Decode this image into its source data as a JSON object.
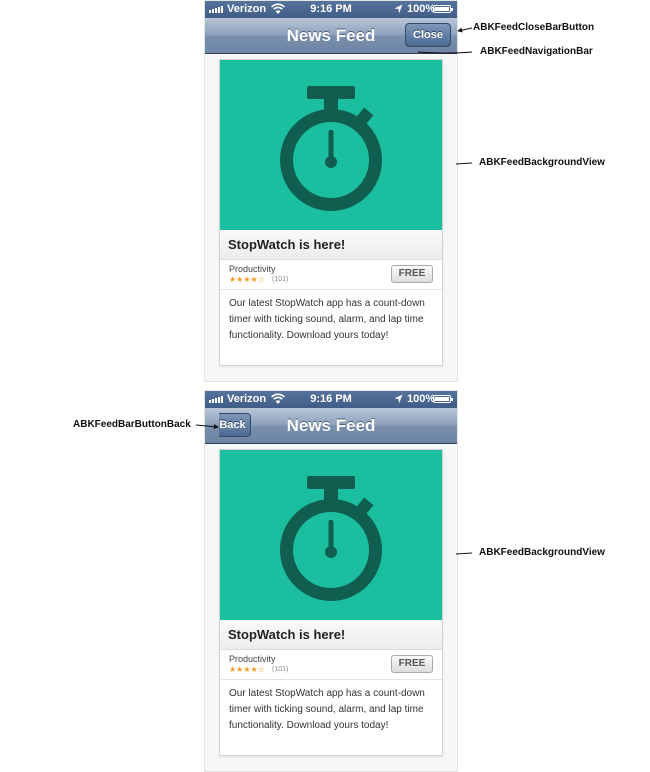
{
  "screens": [
    {
      "status": {
        "carrier": "Verizon",
        "time": "9:16 PM",
        "battery": "100%"
      },
      "nav": {
        "title": "News Feed",
        "right_button": "Close"
      },
      "card": {
        "title": "StopWatch is here!",
        "category": "Productivity",
        "stars": "★★★★☆",
        "rating_count": "(101)",
        "price_button": "FREE",
        "description": "Our latest StopWatch app has a count-down timer with ticking sound, alarm, and lap time functionality. Download yours today!"
      }
    },
    {
      "status": {
        "carrier": "Verizon",
        "time": "9:16 PM",
        "battery": "100%"
      },
      "nav": {
        "title": "News Feed",
        "left_button": "Back"
      },
      "card": {
        "title": "StopWatch is here!",
        "category": "Productivity",
        "stars": "★★★★☆",
        "rating_count": "(101)",
        "price_button": "FREE",
        "description": "Our latest StopWatch app has a count-down timer with ticking sound, alarm, and lap time functionality. Download yours today!"
      }
    }
  ],
  "annotations": {
    "close_button": "ABKFeedCloseBarButton",
    "navigation_bar": "ABKFeedNavigationBar",
    "background_view_top": "ABKFeedBackgroundView",
    "back_button": "ABKFeedBarButtonBack",
    "background_view_bottom": "ABKFeedBackgroundView"
  },
  "colors": {
    "hero": "#1bbfa0",
    "icon": "#0f5e4f",
    "nav_bar": "#7a90ae",
    "status_bar": "#4a6791"
  },
  "icons": {
    "hero": "stopwatch-icon"
  }
}
